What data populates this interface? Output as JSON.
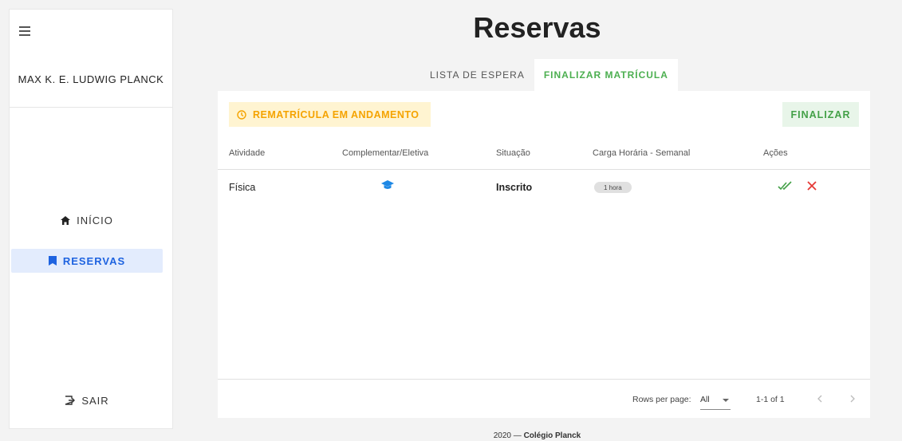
{
  "sidebar": {
    "user_name": "MAX K. E. LUDWIG PLANCK",
    "items": [
      {
        "label": "INÍCIO",
        "icon": "home-icon"
      },
      {
        "label": "RESERVAS",
        "icon": "bookmark-icon"
      }
    ],
    "logout_label": "SAIR"
  },
  "page": {
    "title": "Reservas",
    "tabs": [
      {
        "label": "LISTA DE ESPERA",
        "active": false
      },
      {
        "label": "FINALIZAR MATRÍCULA",
        "active": true
      }
    ]
  },
  "card": {
    "status": "REMATRÍCULA EM ANDAMENTO",
    "finalize_label": "FINALIZAR",
    "columns": [
      "Atividade",
      "Complementar/Eletiva",
      "Situação",
      "Carga Horária - Semanal",
      "Ações"
    ],
    "rows": [
      {
        "atividade": "Física",
        "tipo_icon": "graduation-cap-icon",
        "situacao": "Inscrito",
        "carga": "1 hora"
      }
    ],
    "pagination": {
      "rows_per_page_label": "Rows per page:",
      "rows_per_page_value": "All",
      "range": "1-1 of 1"
    }
  },
  "footer": {
    "year": "2020 —",
    "org": "Colégio Planck"
  },
  "colors": {
    "accent_blue": "#1e63e0",
    "success_green": "#43a047",
    "warning_amber": "#f5a300",
    "danger_red": "#e53935"
  }
}
